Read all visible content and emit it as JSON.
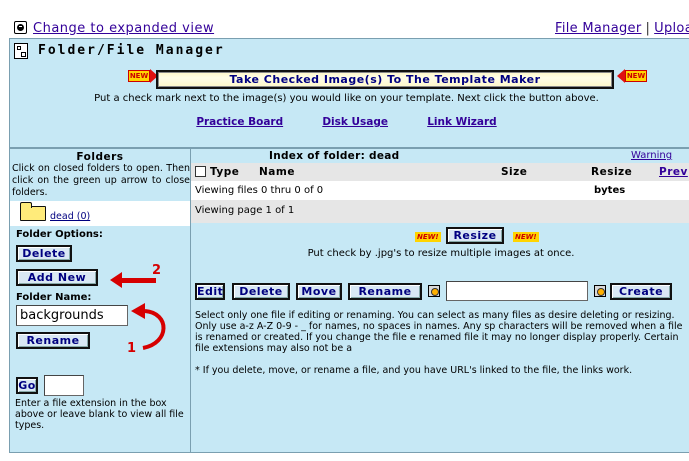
{
  "topbar": {
    "expand_link": "Change to expanded view",
    "file_manager_link": "File Manager",
    "separator": "|",
    "upload_link": "Uploa"
  },
  "header": {
    "title": "Folder/File Manager",
    "new_badge": "NEW",
    "template_button": "Take Checked Image(s) To The Template Maker",
    "template_hint": "Put a check mark next to the image(s) you would like on your template. Next click the button above.",
    "links": [
      "Practice Board",
      "Disk Usage",
      "Link Wizard"
    ]
  },
  "folders": {
    "title": "Folders",
    "description": "Click on closed folders to open. Then click on the green up arrow to close folders.",
    "folder_name": "dead (0)",
    "options_label": "Folder Options:",
    "delete_button": "Delete",
    "add_new_button": "Add New",
    "folder_name_label": "Folder Name:",
    "folder_name_value": "backgrounds",
    "rename_button": "Rename",
    "go_button": "Go",
    "extension_value": "",
    "help_text": "Enter a file extension in the box above or leave blank to view all file types.",
    "annotation_2": "2",
    "annotation_1": "1"
  },
  "files": {
    "index_title": "Index of folder: dead",
    "warning_link": "Warning",
    "columns": {
      "type": "Type",
      "name": "Name",
      "size": "Size",
      "resize": "Resize",
      "prev": "Prev"
    },
    "viewing_files": "Viewing files 0 thru 0 of 0",
    "bytes_label": "bytes",
    "viewing_page": "Viewing page 1 of 1",
    "new_badge": "NEW!",
    "resize_button": "Resize",
    "resize_hint": "Put check by .jpg's to resize multiple images at once.",
    "edit_button": "Edit",
    "delete_button": "Delete",
    "move_button": "Move",
    "rename_button": "Rename",
    "create_button": "Create",
    "file_input_value": "",
    "help_text": "Select only one file if editing or renaming. You can select as many files as desire deleting or resizing. Only use a-z A-Z 0-9 - _ for names, no spaces in names. Any sp characters will be removed when a file is renamed or created. If you change the file e renamed file it may no longer display properly. Certain file extensions may also not be a\n\n* If you delete, move, or rename a file, and you have URL's linked to the file, the links work."
  },
  "colors": {
    "panel_bg": "#c6e8f5",
    "link": "#330099",
    "button_text": "#000080",
    "annotation_red": "#d60000"
  }
}
